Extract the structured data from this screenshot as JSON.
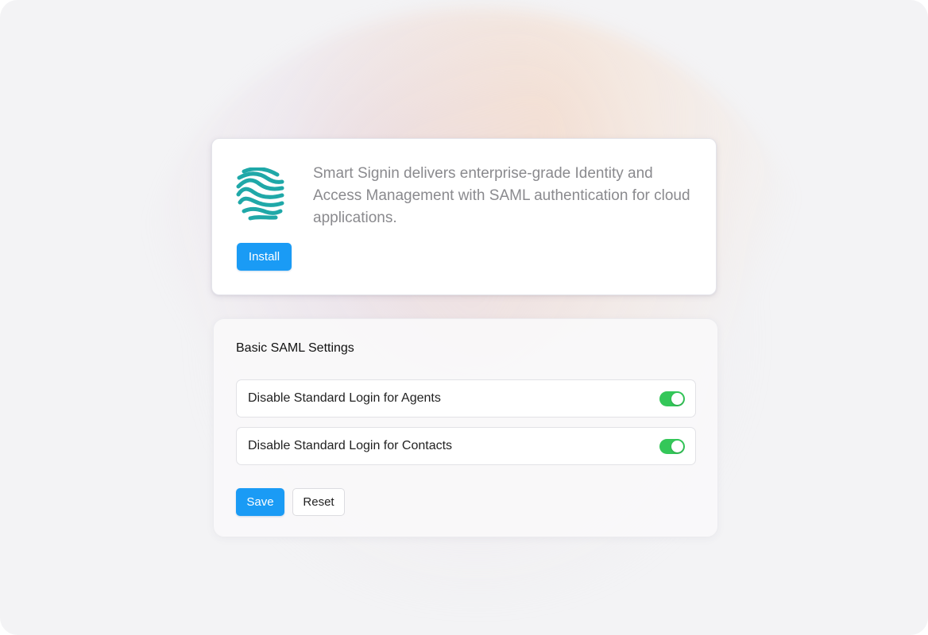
{
  "app": {
    "logo_icon": "fingerprint-wave-icon",
    "description": "Smart Signin delivers enterprise-grade Identity and Access Management with SAML authentication for cloud applications.",
    "install_label": "Install"
  },
  "settings": {
    "title": "Basic SAML Settings",
    "toggles": [
      {
        "label": "Disable Standard Login for Agents",
        "enabled": true
      },
      {
        "label": "Disable Standard Login for Contacts",
        "enabled": true
      }
    ],
    "save_label": "Save",
    "reset_label": "Reset"
  },
  "colors": {
    "primary": "#1a9bf5",
    "toggle_on": "#34c759",
    "logo": "#1fa8a8"
  }
}
